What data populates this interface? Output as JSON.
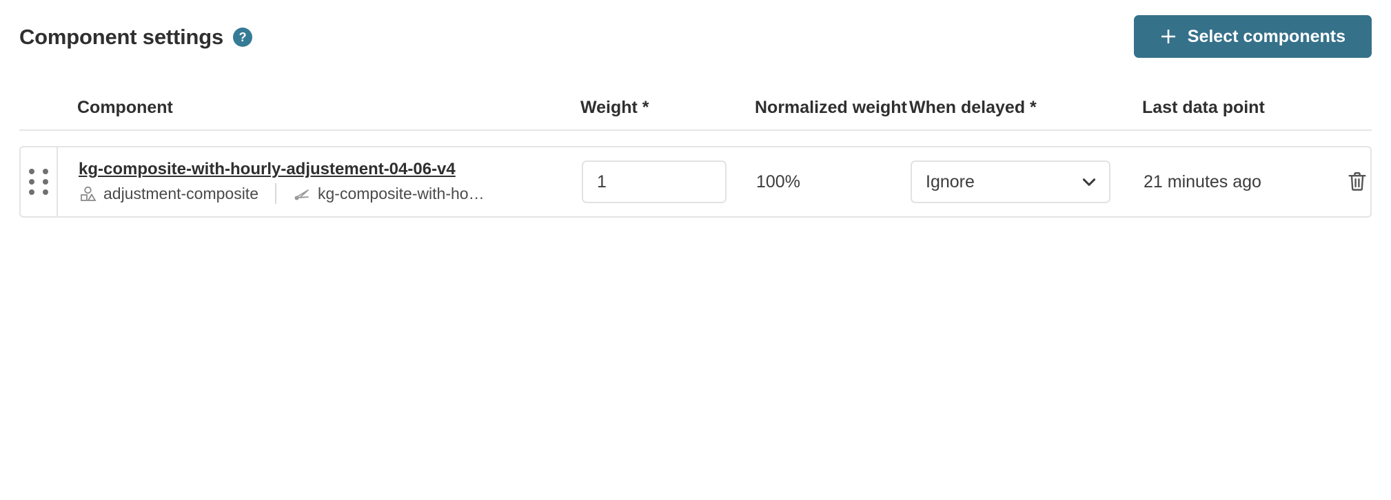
{
  "header": {
    "title": "Component settings",
    "help_icon_label": "?",
    "select_components_label": "Select components",
    "accent_color": "#36718a",
    "help_icon_color": "#367b96"
  },
  "table": {
    "columns": [
      {
        "key": "handle",
        "label": ""
      },
      {
        "key": "name",
        "label": "Component"
      },
      {
        "key": "weight",
        "label": "Weight *"
      },
      {
        "key": "norm",
        "label": "Normalized weight"
      },
      {
        "key": "delayed",
        "label": "When delayed *"
      },
      {
        "key": "last",
        "label": "Last data point"
      },
      {
        "key": "actions",
        "label": ""
      }
    ],
    "rows": [
      {
        "drag_handle_icon": "drag-dots-icon",
        "component_name": "kg-composite-with-hourly-adjustement-04-06-v4",
        "meta": [
          {
            "icon": "shapes-composite-icon",
            "label": "adjustment-composite"
          },
          {
            "icon": "metric-arrow-icon",
            "label": "kg-composite-with-ho…"
          }
        ],
        "weight_value": "1",
        "weight_placeholder": "",
        "normalized_weight": "100%",
        "when_delayed_value": "Ignore",
        "when_delayed_options": [
          "Ignore"
        ],
        "last_data_point": "21 minutes ago",
        "delete_icon": "trash-icon"
      }
    ]
  }
}
